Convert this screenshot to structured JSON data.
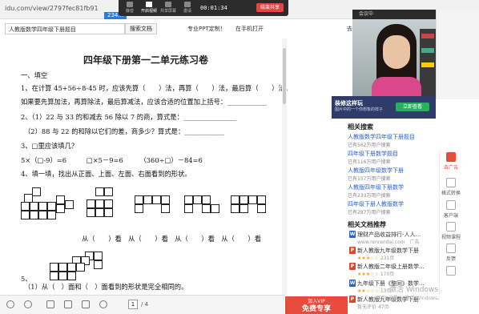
{
  "browser": {
    "url": "idu.com/view/2797fec81fb91",
    "tab_label": "234..."
  },
  "meeting": {
    "toolbar": [
      {
        "name": "mic",
        "label": "静音"
      },
      {
        "name": "video",
        "label": "开启视频"
      },
      {
        "name": "share",
        "label": "共享屏幕"
      },
      {
        "name": "invite",
        "label": "邀请"
      },
      {
        "name": "members",
        "label": "成员"
      },
      {
        "name": "more",
        "label": "更多"
      }
    ],
    "timer": "00:01:34",
    "end_label": "结束共享",
    "video_title": "会议中"
  },
  "search": {
    "value": "人教版数学四年级下册题目",
    "button": "搜索文档",
    "ppt_link": "专业PPT定制！",
    "mobile_link": "在手机打开",
    "right_cut": "去"
  },
  "document": {
    "title": "四年级下册第一二单元练习卷",
    "lines": [
      "一、填空",
      "1、在计算 45+56÷8-45 时，应该先算（　　）法，再算（　　）法，最后算（　　）法。",
      "如果要先算加法，再算除法，最后算减法，应该合适的位置加上括号：____________",
      "2、（1）22 与 33 的和减去 56 除以 7 的商，算式是：________________",
      "（2）88 与 22 的和除以它们的差，商多少？算式是：____________",
      "3、□里应该填几？",
      "5×（□-9）=6　　　□×5－9=6　　　（360÷□）－84=6",
      "4、填一填，找出从正面、上面、左面、右面看到的形状。",
      "从（　　）看　从（　　）看　从（　　）看　从（　　）看",
      "5、",
      "（1）从（　）面和（　）面看到的形状是完全相同的。"
    ],
    "page_current": "1",
    "page_total": "/ 4",
    "vip_small": "加入VIP",
    "vip_big": "免费专享"
  },
  "ad": {
    "line1": "装修这样玩",
    "line2": "图片中的一个你想象的样子",
    "button": "立即查看"
  },
  "related_search": {
    "heading": "相关搜索",
    "items": [
      {
        "title": "人教版数学四年级下册题目",
        "sub": "已有562万用户搜索"
      },
      {
        "title": "四年级下册数学题目",
        "sub": "已有116万用户搜索"
      },
      {
        "title": "人教版四年级数学下册",
        "sub": "已有157万用户搜索"
      },
      {
        "title": "人教版四年级下册数学",
        "sub": "已有233万用户搜索"
      },
      {
        "title": "四年级下册人教版数学",
        "sub": "已有287万用户搜索"
      }
    ]
  },
  "related_docs": {
    "heading": "相关文档推荐",
    "items": [
      {
        "icon": "W",
        "color": "#2a62c9",
        "title": "理财产品收益排行-人人...",
        "sub": "www.renrendai.com　广告",
        "stars": ""
      },
      {
        "icon": "P",
        "color": "#d9482b",
        "title": "新人教版九年级数学下册",
        "sub": "231页",
        "stars": "★★★☆☆"
      },
      {
        "icon": "P",
        "color": "#d9482b",
        "title": "新人教版二年级上册数学...",
        "sub": "170页",
        "stars": "★★★☆☆"
      },
      {
        "icon": "W",
        "color": "#2a62c9",
        "title": "九年级下册《整同》数学...",
        "sub": "13页",
        "stars": "★★☆☆☆"
      },
      {
        "icon": "P",
        "color": "#d9482b",
        "title": "新人教版九年级数学下册",
        "sub": "47页",
        "stars": "★★★☆☆"
      }
    ],
    "footnote": "暂无评价"
  },
  "rail": [
    {
      "name": "ad-rail",
      "label": "去广告"
    },
    {
      "name": "format",
      "label": "格式转换"
    },
    {
      "name": "client",
      "label": "客户端"
    },
    {
      "name": "video-course",
      "label": "视频课程"
    },
    {
      "name": "feedback",
      "label": "反馈"
    },
    {
      "name": "top",
      "label": ""
    }
  ],
  "watermark": {
    "line1": "激活 Windows",
    "line2": "转到\"设置\"以激活 Windows。"
  }
}
